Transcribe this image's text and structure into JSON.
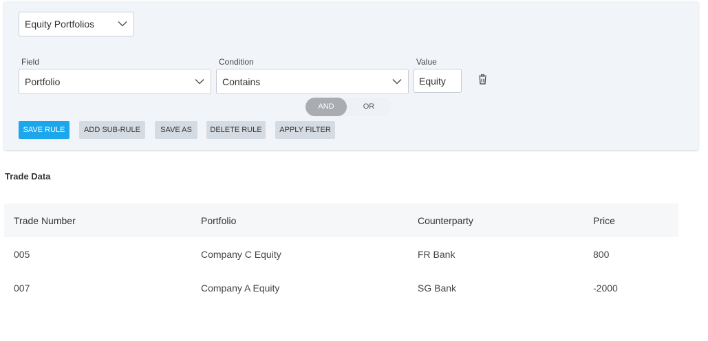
{
  "filter": {
    "saved_filter_value": "Equity Portfolios",
    "field_label": "Field",
    "field_value": "Portfolio",
    "condition_label": "Condition",
    "condition_value": "Contains",
    "value_label": "Value",
    "value_value": "Equity",
    "combinator": {
      "and_label": "AND",
      "or_label": "OR",
      "selected": "AND"
    },
    "buttons": {
      "save_rule": "SAVE RULE",
      "add_sub_rule": "ADD SUB-RULE",
      "save_as": "SAVE AS",
      "delete_rule": "DELETE RULE",
      "apply_filter": "APPLY FILTER"
    },
    "icons": {
      "dropdown": "chevron-down-icon",
      "delete": "trash-icon"
    },
    "colors": {
      "primary": "#1ca7ec",
      "secondary_button": "#d5dbe3",
      "toggle_active": "#a9acb1",
      "panel_bg": "#f1f4f9"
    }
  },
  "trade_data": {
    "title": "Trade Data",
    "columns": [
      "Trade Number",
      "Portfolio",
      "Counterparty",
      "Price"
    ],
    "rows": [
      [
        "005",
        "Company C Equity",
        "FR Bank",
        "800"
      ],
      [
        "007",
        "Company A Equity",
        "SG Bank",
        "-2000"
      ]
    ]
  }
}
